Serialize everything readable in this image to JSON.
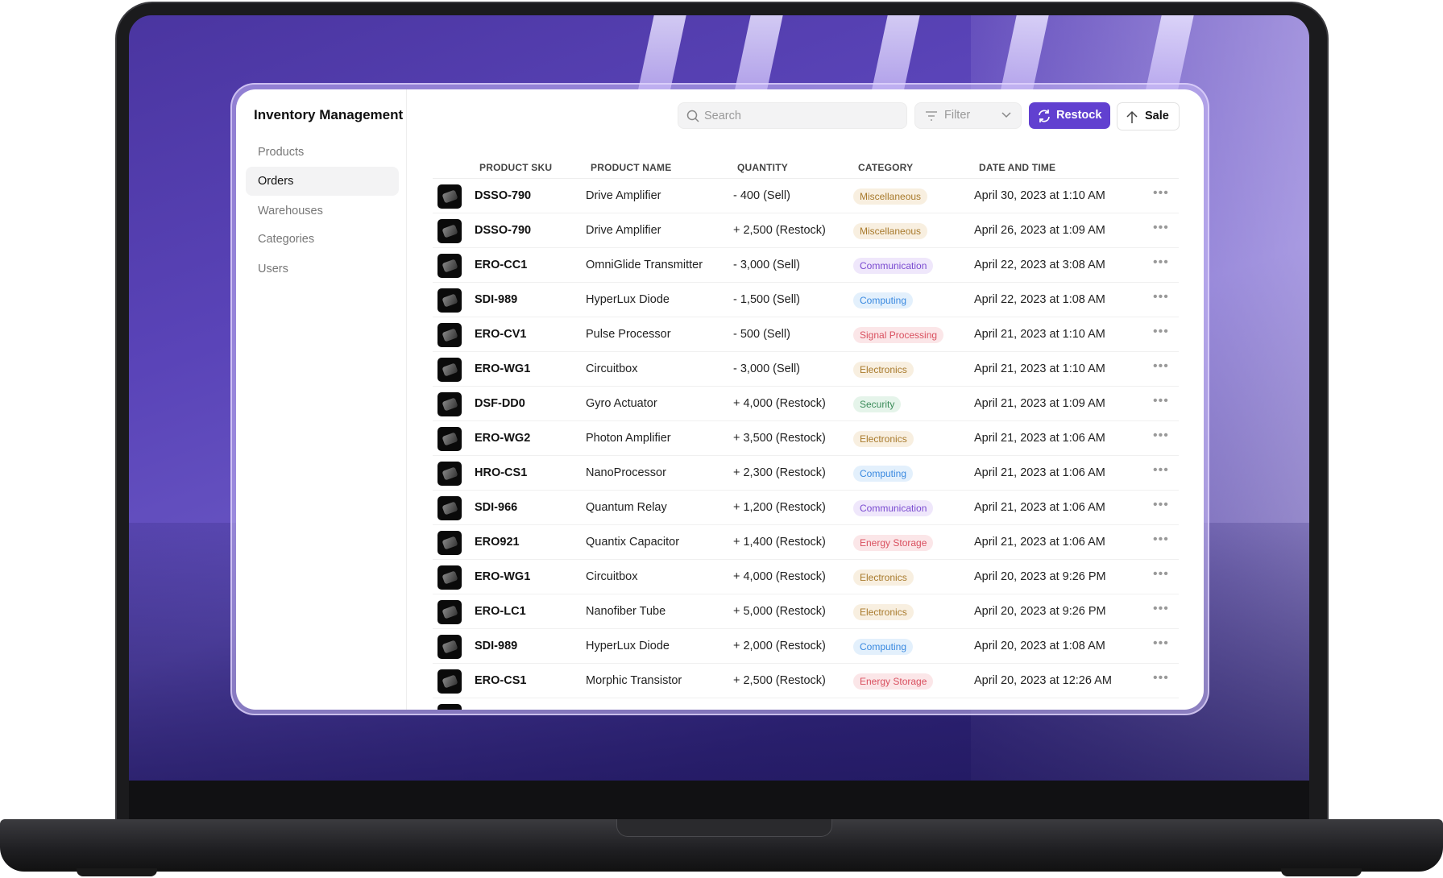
{
  "app": {
    "title": "Inventory Management"
  },
  "sidebar": {
    "items": [
      {
        "label": "Products"
      },
      {
        "label": "Orders",
        "active": true
      },
      {
        "label": "Warehouses"
      },
      {
        "label": "Categories"
      },
      {
        "label": "Users"
      }
    ]
  },
  "toolbar": {
    "search_placeholder": "Search",
    "search_value": "",
    "filter_label": "Filter",
    "restock_label": "Restock",
    "sale_label": "Sale",
    "accent": "#6140d0"
  },
  "table": {
    "headers": [
      "PRODUCT SKU",
      "PRODUCT NAME",
      "QUANTITY",
      "CATEGORY",
      "DATE AND TIME"
    ],
    "rows": [
      {
        "sku": "DSSO-790",
        "name": "Drive Amplifier",
        "qty": "- 400 (Sell)",
        "cat": "Miscellaneous",
        "date": "April 30, 2023 at 1:10 AM"
      },
      {
        "sku": "DSSO-790",
        "name": "Drive Amplifier",
        "qty": "+ 2,500 (Restock)",
        "cat": "Miscellaneous",
        "date": "April 26, 2023 at 1:09 AM"
      },
      {
        "sku": "ERO-CC1",
        "name": "OmniGlide Transmitter",
        "qty": "- 3,000 (Sell)",
        "cat": "Communication",
        "date": "April 22, 2023 at 3:08 AM"
      },
      {
        "sku": "SDI-989",
        "name": "HyperLux Diode",
        "qty": "- 1,500 (Sell)",
        "cat": "Computing",
        "date": "April 22, 2023 at 1:08 AM"
      },
      {
        "sku": "ERO-CV1",
        "name": "Pulse Processor",
        "qty": "- 500 (Sell)",
        "cat": "Signal Processing",
        "date": "April 21, 2023 at 1:10 AM"
      },
      {
        "sku": "ERO-WG1",
        "name": "Circuitbox",
        "qty": "- 3,000 (Sell)",
        "cat": "Electronics",
        "date": "April 21, 2023 at 1:10 AM"
      },
      {
        "sku": "DSF-DD0",
        "name": "Gyro Actuator",
        "qty": "+ 4,000 (Restock)",
        "cat": "Security",
        "date": "April 21, 2023 at 1:09 AM"
      },
      {
        "sku": "ERO-WG2",
        "name": "Photon Amplifier",
        "qty": "+ 3,500 (Restock)",
        "cat": "Electronics",
        "date": "April 21, 2023 at 1:06 AM"
      },
      {
        "sku": "HRO-CS1",
        "name": "NanoProcessor",
        "qty": "+ 2,300 (Restock)",
        "cat": "Computing",
        "date": "April 21, 2023 at 1:06 AM"
      },
      {
        "sku": "SDI-966",
        "name": "Quantum Relay",
        "qty": "+ 1,200 (Restock)",
        "cat": "Communication",
        "date": "April 21, 2023 at 1:06 AM"
      },
      {
        "sku": "ERO921",
        "name": "Quantix Capacitor",
        "qty": "+ 1,400 (Restock)",
        "cat": "Energy Storage",
        "date": "April 21, 2023 at 1:06 AM"
      },
      {
        "sku": "ERO-WG1",
        "name": "Circuitbox",
        "qty": "+ 4,000 (Restock)",
        "cat": "Electronics",
        "date": "April 20, 2023 at 9:26 PM"
      },
      {
        "sku": "ERO-LC1",
        "name": "Nanofiber Tube",
        "qty": "+ 5,000 (Restock)",
        "cat": "Electronics",
        "date": "April 20, 2023 at 9:26 PM"
      },
      {
        "sku": "SDI-989",
        "name": "HyperLux Diode",
        "qty": "+ 2,000 (Restock)",
        "cat": "Computing",
        "date": "April 20, 2023 at 1:08 AM"
      },
      {
        "sku": "ERO-CS1",
        "name": "Morphic Transistor",
        "qty": "+ 2,500 (Restock)",
        "cat": "Energy Storage",
        "date": "April 20, 2023 at 12:26 AM"
      }
    ]
  },
  "category_colors": {
    "Miscellaneous": {
      "bg": "#f8efe0",
      "fg": "#a87a2c"
    },
    "Electronics": {
      "bg": "#f8efe0",
      "fg": "#a87a2c"
    },
    "Communication": {
      "bg": "#efe7fb",
      "fg": "#7a4bd0"
    },
    "Computing": {
      "bg": "#e3f0fc",
      "fg": "#3b8ae0"
    },
    "Signal Processing": {
      "bg": "#fbe6e8",
      "fg": "#d9505f"
    },
    "Energy Storage": {
      "bg": "#fbe6e8",
      "fg": "#d9505f"
    },
    "Security": {
      "bg": "#e5f4ea",
      "fg": "#3c8c5a"
    }
  },
  "icons": {
    "search": "search-icon",
    "filter": "filter-icon",
    "chevron": "chevron-down-icon",
    "restock": "refresh-icon",
    "sale": "arrow-up-icon",
    "more": "more-horizontal-icon"
  }
}
